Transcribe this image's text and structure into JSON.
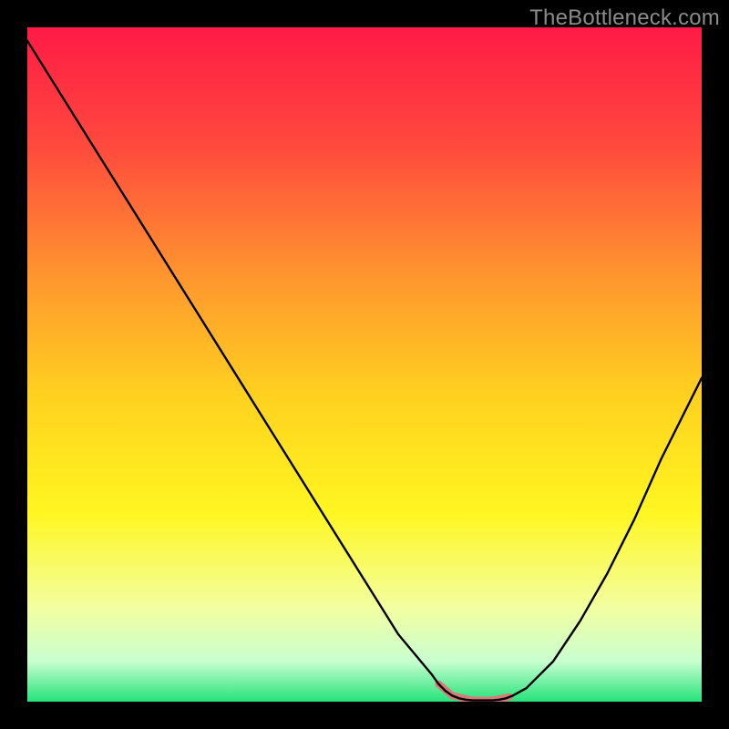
{
  "watermark": "TheBottleneck.com",
  "chart_data": {
    "type": "line",
    "title": "",
    "xlabel": "",
    "ylabel": "",
    "xlim": [
      0,
      100
    ],
    "ylim": [
      0,
      100
    ],
    "background_gradient_stops": [
      {
        "offset": 0.0,
        "color": "#ff1a46"
      },
      {
        "offset": 0.18,
        "color": "#ff4b3d"
      },
      {
        "offset": 0.38,
        "color": "#ff9a2e"
      },
      {
        "offset": 0.55,
        "color": "#ffd21f"
      },
      {
        "offset": 0.72,
        "color": "#fff621"
      },
      {
        "offset": 0.86,
        "color": "#f3ffa0"
      },
      {
        "offset": 0.94,
        "color": "#c9ffd0"
      },
      {
        "offset": 1.0,
        "color": "#25e27a"
      }
    ],
    "series": [
      {
        "name": "bottleneck-curve",
        "color": "#000000",
        "width": 2.4,
        "x": [
          0,
          5,
          10,
          15,
          20,
          25,
          30,
          35,
          40,
          45,
          50,
          55,
          60,
          61,
          62,
          63,
          64,
          65,
          66,
          67,
          68,
          69,
          70,
          71,
          72,
          74,
          78,
          82,
          86,
          90,
          94,
          100
        ],
        "y": [
          98,
          90,
          82,
          74,
          66,
          58,
          50,
          42,
          34,
          26,
          18,
          10,
          4,
          2.6,
          1.6,
          0.9,
          0.5,
          0.3,
          0.2,
          0.2,
          0.2,
          0.2,
          0.3,
          0.5,
          0.9,
          2,
          6,
          12,
          19,
          27,
          36,
          48
        ]
      },
      {
        "name": "optimal-band",
        "color": "#d77a78",
        "width": 8,
        "cap": "round",
        "x": [
          61.0,
          63.0,
          66.0,
          69.0,
          71.5
        ],
        "y": [
          2.6,
          0.9,
          0.2,
          0.2,
          0.7
        ]
      }
    ]
  }
}
